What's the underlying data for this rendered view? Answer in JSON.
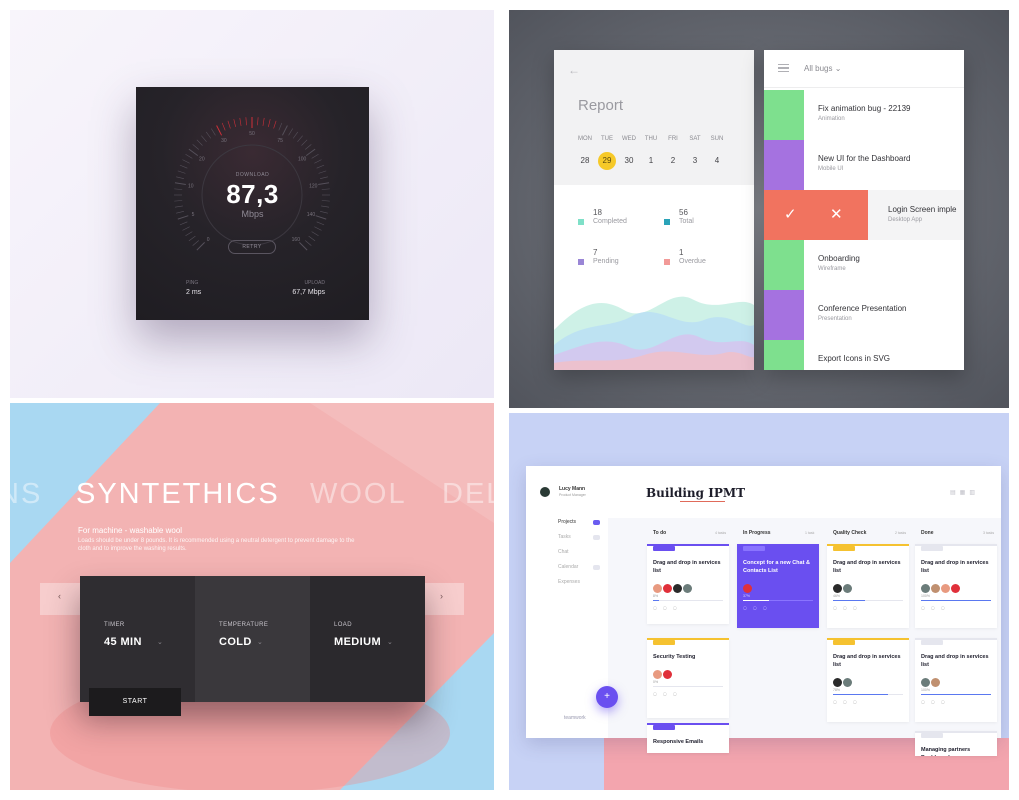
{
  "speed_test": {
    "gauge_ticks": [
      "0",
      "5",
      "10",
      "20",
      "30",
      "50",
      "75",
      "100",
      "120",
      "140",
      "160"
    ],
    "download_label": "DOWNLOAD",
    "speed": "87,3",
    "unit": "Mbps",
    "retry_label": "RETRY",
    "ping_label": "PING",
    "ping_value": "2 ms",
    "upload_label": "UPLOAD",
    "upload_value": "67,7 Mbps",
    "accent": "#e0303a"
  },
  "report": {
    "title": "Report",
    "weekdays": [
      "MON",
      "TUE",
      "WED",
      "THU",
      "FRI",
      "SAT",
      "SUN"
    ],
    "days": [
      "28",
      "29",
      "30",
      "1",
      "2",
      "3",
      "4"
    ],
    "selected_day": "29",
    "stats": [
      {
        "value": "18",
        "label": "Completed",
        "color": "#7fe0c8"
      },
      {
        "value": "56",
        "label": "Total",
        "color": "#2aa3b8"
      },
      {
        "value": "7",
        "label": "Pending",
        "color": "#9a86d6"
      },
      {
        "value": "1",
        "label": "Overdue",
        "color": "#f29a98"
      }
    ]
  },
  "bugs": {
    "filter_label": "All bugs",
    "items": [
      {
        "title": "Fix animation bug - 22139",
        "sub": "Animation",
        "color": "#7ee08e"
      },
      {
        "title": "New UI for the Dashboard",
        "sub": "Mobile UI",
        "color": "#a572e0"
      },
      {
        "title": "Login Screen imple",
        "sub": "Desktop App",
        "color": "#f1735f"
      },
      {
        "title": "Onboarding",
        "sub": "Wireframe",
        "color": "#7ee08e"
      },
      {
        "title": "Conference Presentation",
        "sub": "Presentation",
        "color": "#a572e0"
      },
      {
        "title": "Export Icons in SVG",
        "sub": "",
        "color": "#7ee08e"
      }
    ]
  },
  "synthetics": {
    "words": [
      "NS",
      "SYNTETHICS",
      "WOOL",
      "DEL"
    ],
    "desc_head": "For machine - washable wool",
    "desc_body": "Loads should be under 8 pounds. It is recommended using a neutral detergent to prevent damage to the cloth and to improve the washing results.",
    "segments": [
      {
        "label": "TIMER",
        "value": "45 MIN"
      },
      {
        "label": "TEMPERATURE",
        "value": "COLD"
      },
      {
        "label": "LOAD",
        "value": "MEDIUM"
      }
    ],
    "start_label": "START"
  },
  "ipmt": {
    "user_name": "Lucy Mann",
    "user_role": "Product Manager",
    "nav": [
      "Projects",
      "Tasks",
      "Chat",
      "Calendar",
      "Expenses"
    ],
    "active_nav": "Projects",
    "logo": "teamwork",
    "fab_label": "+",
    "title": "Building IPMT",
    "columns": [
      {
        "name": "To do",
        "count": "4 tasks"
      },
      {
        "name": "In Progress",
        "count": "1 task"
      },
      {
        "name": "Quality Check",
        "count": "2 tasks"
      },
      {
        "name": "Done",
        "count": "3 tasks"
      }
    ],
    "cards": [
      {
        "title": "Drag and drop in services list",
        "pct": "8%",
        "progress": 0.08,
        "col": 0
      },
      {
        "title": "Security Testing",
        "pct": "0%",
        "progress": 0.0,
        "col": 0
      },
      {
        "title": "Responsive Emails",
        "pct": "",
        "progress": 0.0,
        "col": 0
      },
      {
        "title": "Concept for a new Chat & Contacts List",
        "pct": "37%",
        "progress": 0.37,
        "col": 1
      },
      {
        "title": "Drag and drop in services list",
        "pct": "46%",
        "progress": 0.46,
        "col": 2
      },
      {
        "title": "Drag and drop in services list",
        "pct": "78%",
        "progress": 0.78,
        "col": 2
      },
      {
        "title": "Drag and drop in services list",
        "pct": "100%",
        "progress": 1.0,
        "col": 3
      },
      {
        "title": "Drag and drop in services list",
        "pct": "100%",
        "progress": 1.0,
        "col": 3
      },
      {
        "title": "Managing partners Dashboard",
        "pct": "",
        "progress": 0.0,
        "col": 3
      }
    ]
  }
}
